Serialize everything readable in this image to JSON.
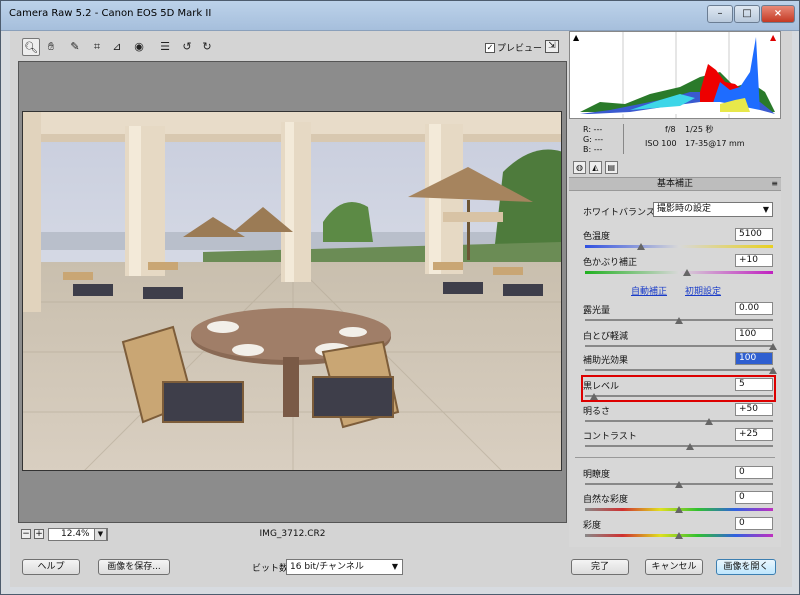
{
  "window": {
    "title": "Camera Raw 5.2  -  Canon EOS 5D Mark II"
  },
  "toolbar": {
    "tools": [
      "zoom-icon",
      "hand-icon",
      "white-balance-icon",
      "color-sampler-icon",
      "crop-icon",
      "straighten-icon",
      "red-eye-icon",
      "preferences-icon",
      "rotate-left-icon",
      "rotate-right-icon"
    ],
    "preview_label": "プレビュー",
    "preview_checked": true
  },
  "status": {
    "zoom": "12.4%",
    "filename": "IMG_3712.CR2"
  },
  "readout": {
    "r": "R:   ---",
    "g": "G:   ---",
    "b": "B:   ---",
    "aperture": "f/8",
    "shutter": "1/25 秒",
    "iso": "ISO 100",
    "lens": "17-35@17 mm"
  },
  "panel": {
    "title": "基本補正",
    "white_balance_label": "ホワイトバランス：",
    "white_balance_value": "撮影時の設定",
    "link_auto": "自動補正",
    "link_default": "初期設定",
    "sliders": [
      {
        "label": "色温度",
        "value": "5100",
        "level": 0.3
      },
      {
        "label": "色かぶり補正",
        "value": "+10",
        "level": 0.54
      },
      {
        "label": "露光量",
        "value": "0.00",
        "level": 0.5
      },
      {
        "label": "白とび軽減",
        "value": "100",
        "level": 1.0
      },
      {
        "label": "補助光効果",
        "value": "100",
        "level": 1.0
      },
      {
        "label": "黒レベル",
        "value": "5",
        "level": 0.05
      },
      {
        "label": "明るさ",
        "value": "+50",
        "level": 0.66
      },
      {
        "label": "コントラスト",
        "value": "+25",
        "level": 0.56
      },
      {
        "label": "明瞭度",
        "value": "0",
        "level": 0.5
      },
      {
        "label": "自然な彩度",
        "value": "0",
        "level": 0.5
      },
      {
        "label": "彩度",
        "value": "0",
        "level": 0.5
      }
    ]
  },
  "footer": {
    "help": "ヘルプ",
    "save": "画像を保存...",
    "bit_depth_label": "ビット数：",
    "bit_depth_value": "16 bit/チャンネル",
    "done": "完了",
    "cancel": "キャンセル",
    "open": "画像を開く"
  }
}
